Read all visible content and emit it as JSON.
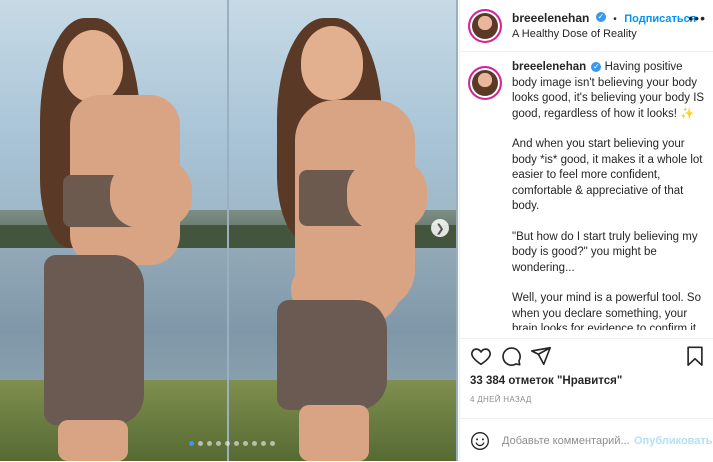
{
  "post": {
    "username": "breeelenehan",
    "separator": "•",
    "follow_label": "Подписаться",
    "subtitle": "A Healthy Dose of Reality",
    "caption_paragraphs": [
      "Having positive body image isn't believing your body looks good, it's believing your body IS good, regardless of how it looks! ✨",
      "And when you start believing your body *is* good, it makes it a whole lot easier to feel more confident, comfortable & appreciative of that body.",
      "\"But how do I start truly believing my body is good?\" you might be wondering...",
      "Well, your mind is a powerful tool. So when you declare something, your brain looks for evidence to confirm it. So if you declare: \"I'm not good enough\", your brain is going to seek everything in your"
    ],
    "likes_text": "33 384 отметок \"Нравится\"",
    "age_text": "4 ДНЕЙ НАЗАД",
    "comment_placeholder": "Добавьте комментарий...",
    "publish_label": "Опубликовать"
  },
  "carousel": {
    "total_slides": 10,
    "active_slide": 1
  },
  "icons": {
    "verified": "verified-badge-icon",
    "more": "more-options-icon",
    "like": "heart-icon",
    "comment": "comment-icon",
    "share": "share-icon",
    "save": "bookmark-icon",
    "emoji": "emoji-icon",
    "next": "chevron-right-icon"
  },
  "colors": {
    "accent": "#0095f6",
    "publish_disabled": "#b2dffc",
    "active_dot": "#3897f0"
  }
}
